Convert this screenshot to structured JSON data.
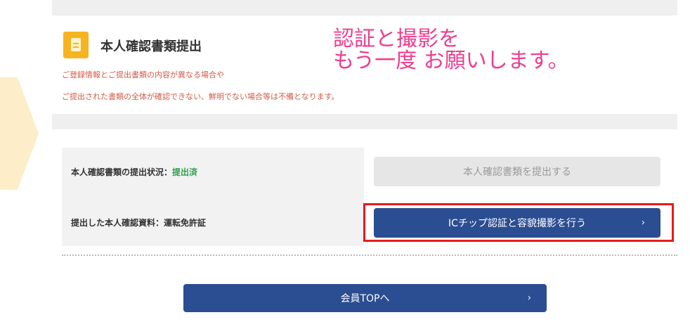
{
  "overlay": {
    "line1": "認証と撮影を",
    "line2": "もう一度 お願いします。",
    "color": "#ee3c8e"
  },
  "section": {
    "icon": "document-icon",
    "title": "本人確認書類提出",
    "note_line1": "ご登録情報とご提出書類の内容が異なる場合や",
    "note_line2": "ご提出された書類の全体が確認できない、鮮明でない場合等は不備となります。"
  },
  "status_row": {
    "label": "本人確認書類の提出状況：",
    "status": "提出済",
    "status_color": "#2ea24a",
    "button_label": "本人確認書類を提出する"
  },
  "document_row": {
    "label": "提出した本人確認資料：運転免許証",
    "button_label": "ICチップ認証と容貌撮影を行う",
    "button_icon": "chevron-right-icon",
    "highlight_color": "#e51b1b"
  },
  "footer": {
    "button_label": "会員TOPへ",
    "button_icon": "chevron-right-icon"
  },
  "colors": {
    "primary": "#2b4d91",
    "accent": "#f6b421",
    "note": "#d45a45"
  }
}
